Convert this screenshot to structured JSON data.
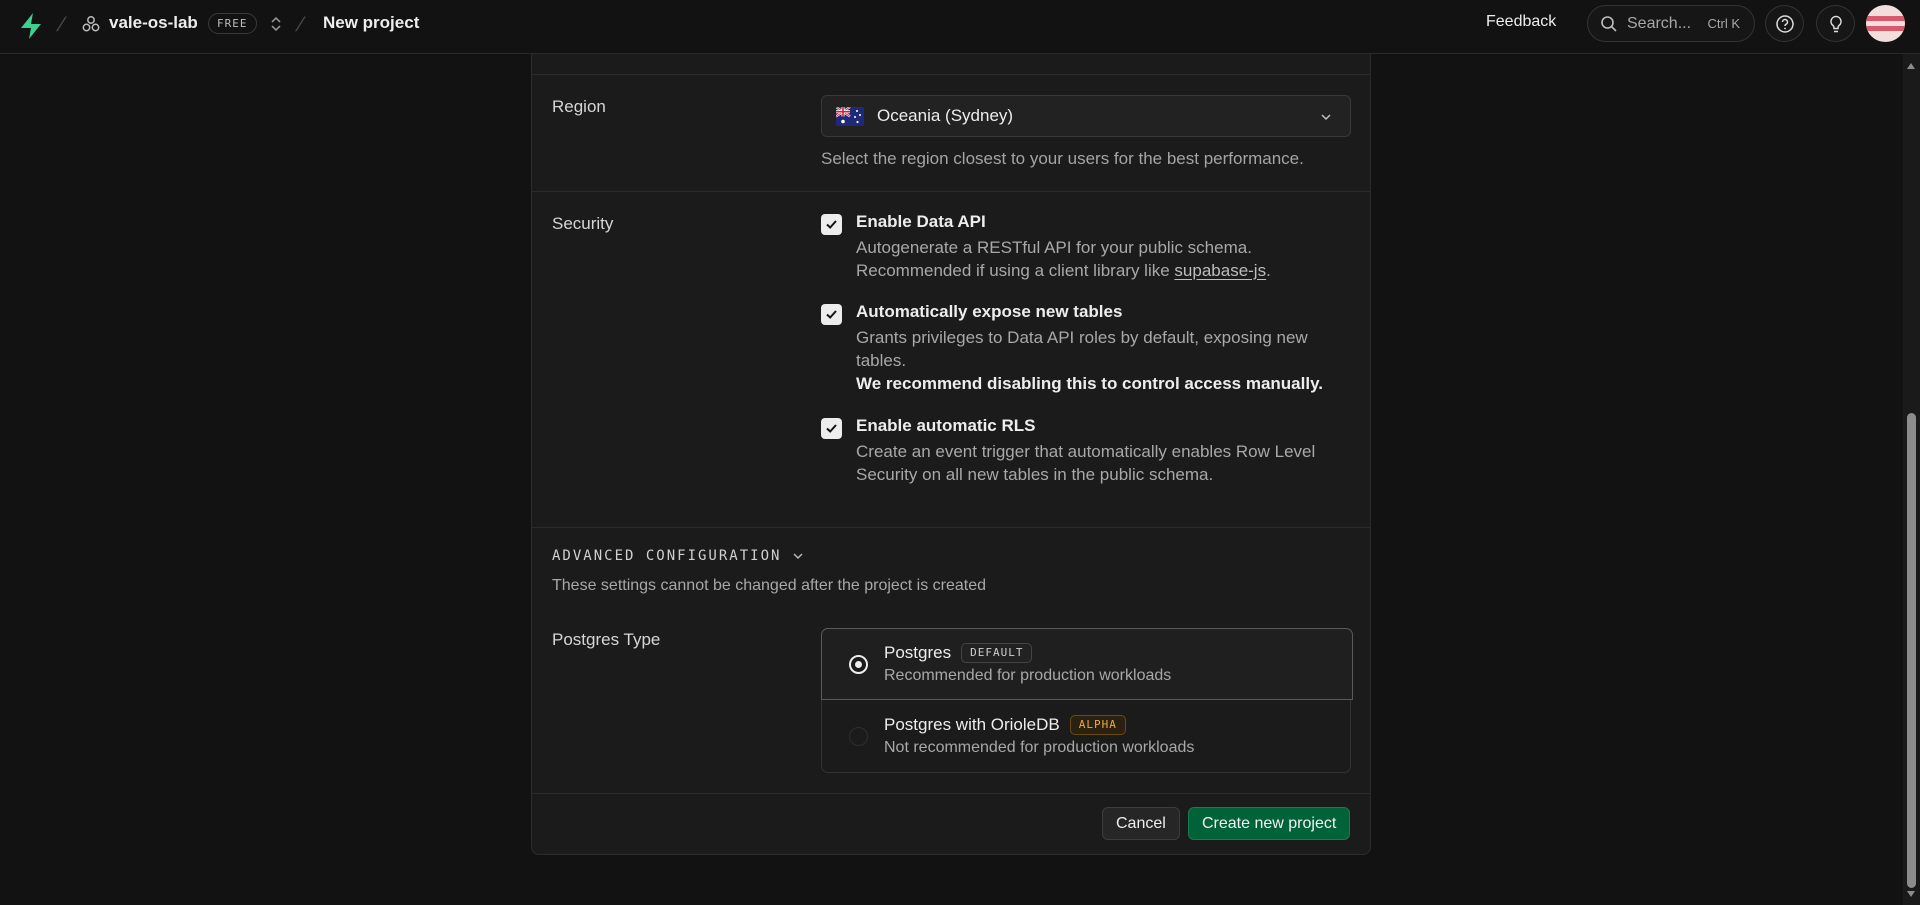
{
  "header": {
    "org_name": "vale-os-lab",
    "plan_badge": "FREE",
    "page_title": "New project",
    "feedback_label": "Feedback",
    "search_placeholder": "Search...",
    "search_shortcut": "Ctrl K",
    "icons": {
      "logo": "supabase-logo-icon",
      "org": "organization-icon",
      "switcher": "chevron-up-down-icon",
      "search": "search-icon",
      "help": "help-circle-icon",
      "tips": "lightbulb-icon"
    }
  },
  "region": {
    "label": "Region",
    "selected": "Oceania (Sydney)",
    "flag": "australia-flag-icon",
    "helper": "Select the region closest to your users for the best performance."
  },
  "security": {
    "label": "Security",
    "options": [
      {
        "title": "Enable Data API",
        "desc_line1": "Autogenerate a RESTful API for your public schema.",
        "desc_line2_prefix": "Recommended if using a client library like ",
        "desc_link": "supabase-js",
        "desc_line2_suffix": ".",
        "checked": true
      },
      {
        "title": "Automatically expose new tables",
        "desc": "Grants privileges to Data API roles by default, exposing new tables.",
        "desc_bold": "We recommend disabling this to control access manually.",
        "checked": true
      },
      {
        "title": "Enable automatic RLS",
        "desc": "Create an event trigger that automatically enables Row Level Security on all new tables in the public schema.",
        "checked": true
      }
    ]
  },
  "advanced": {
    "title": "ADVANCED CONFIGURATION",
    "note": "These settings cannot be changed after the project is created"
  },
  "postgres_type": {
    "label": "Postgres Type",
    "options": [
      {
        "title": "Postgres",
        "tag": "DEFAULT",
        "desc": "Recommended for production workloads",
        "selected": true
      },
      {
        "title": "Postgres with OrioleDB",
        "tag": "ALPHA",
        "desc": "Not recommended for production workloads",
        "selected": false
      }
    ]
  },
  "footer": {
    "cancel_label": "Cancel",
    "create_label": "Create new project"
  },
  "colors": {
    "brand_green": "#3ecf8e",
    "primary_button": "#006239",
    "alpha_tag": "#f0a93a"
  }
}
